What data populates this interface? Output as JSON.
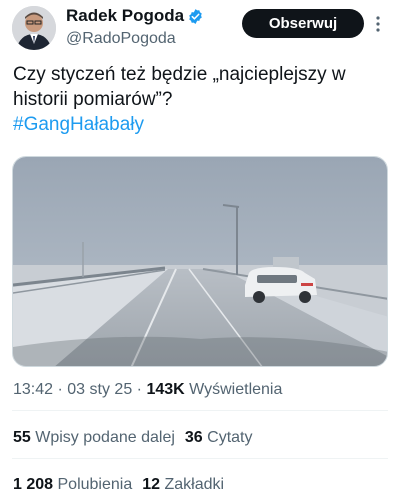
{
  "author": {
    "display_name": "Radek Pogoda",
    "handle": "@RadoPogoda",
    "follow_label": "Obserwuj"
  },
  "tweet": {
    "text": "Czy styczeń też będzie „najcieplejszy w historii pomiarów”?",
    "hashtag": "#GangHałabały"
  },
  "meta": {
    "time": "13:42",
    "separator": "·",
    "date": "03 sty 25",
    "views_count": "143K",
    "views_label": "Wyświetlenia"
  },
  "engagement": {
    "reposts_count": "55",
    "reposts_label": "Wpisy podane dalej",
    "quotes_count": "36",
    "quotes_label": "Cytaty",
    "likes_count": "1 208",
    "likes_label": "Polubienia",
    "bookmarks_count": "12",
    "bookmarks_label": "Zakładki"
  },
  "colors": {
    "accent": "#1d9bf0",
    "text": "#0f1419",
    "secondary": "#536471"
  },
  "icons": [
    "avatar-photo",
    "verified-badge-icon",
    "more-options-icon",
    "snowy-road-photo"
  ]
}
